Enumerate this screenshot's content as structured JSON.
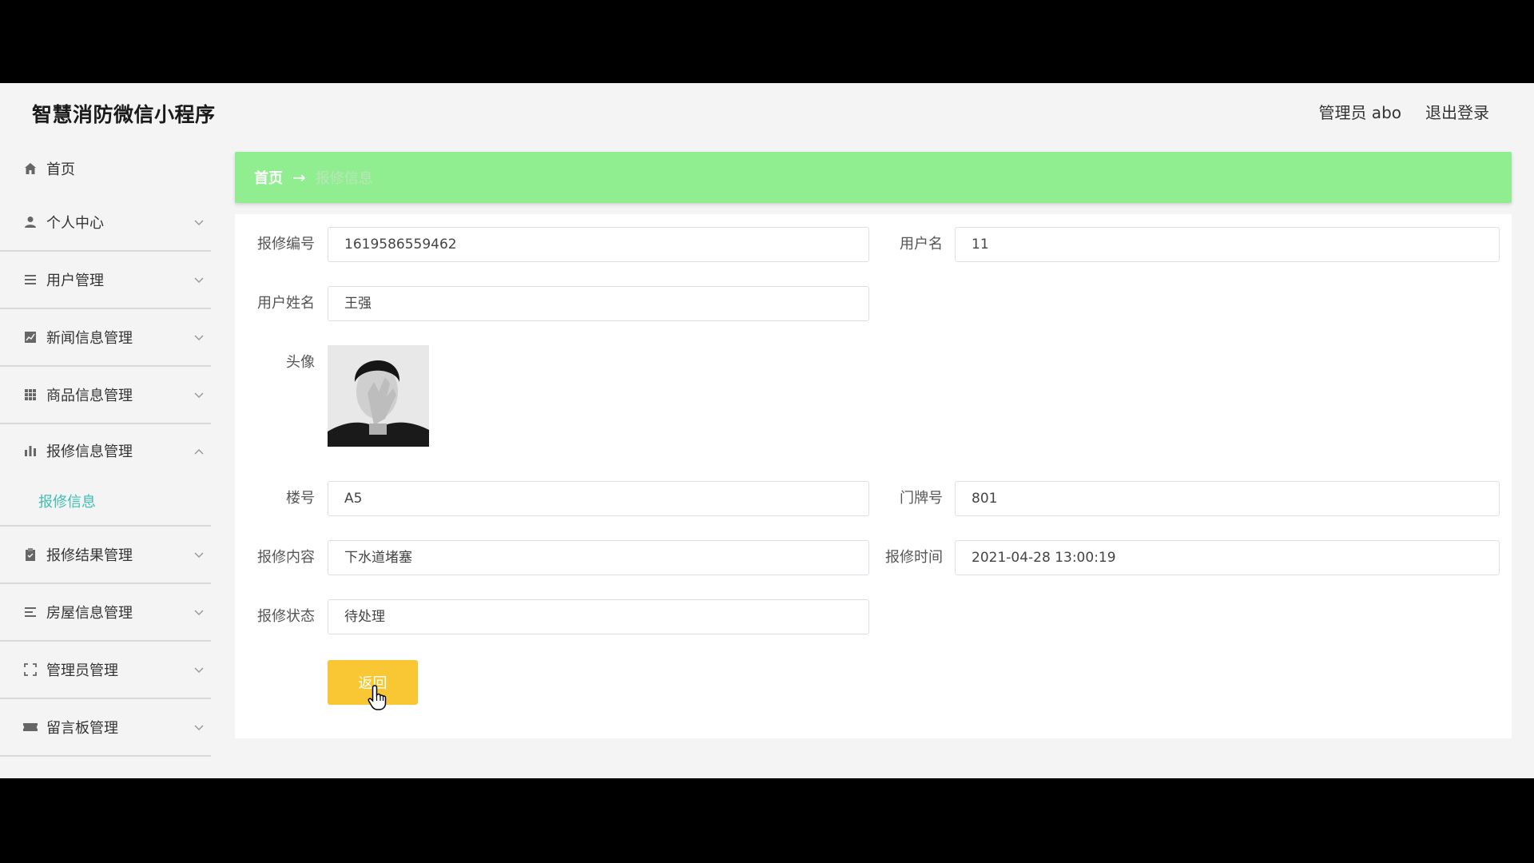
{
  "header": {
    "title": "智慧消防微信小程序",
    "user": "管理员 abo",
    "logout": "退出登录"
  },
  "sidebar": {
    "items": [
      {
        "label": "首页",
        "icon": "home-icon"
      },
      {
        "label": "个人中心",
        "icon": "user-icon"
      },
      {
        "label": "用户管理",
        "icon": "list-icon"
      },
      {
        "label": "新闻信息管理",
        "icon": "chart-line-icon"
      },
      {
        "label": "商品信息管理",
        "icon": "grid-icon"
      },
      {
        "label": "报修信息管理",
        "icon": "bar-chart-icon",
        "expanded": true
      },
      {
        "label": "报修结果管理",
        "icon": "clipboard-icon"
      },
      {
        "label": "房屋信息管理",
        "icon": "menu-icon"
      },
      {
        "label": "管理员管理",
        "icon": "fullscreen-icon"
      },
      {
        "label": "留言板管理",
        "icon": "ticket-icon"
      }
    ],
    "submenu_active": "报修信息"
  },
  "breadcrumb": {
    "home": "首页",
    "arrow": "→",
    "current": "报修信息"
  },
  "form": {
    "repair_no": {
      "label": "报修编号",
      "value": "1619586559462"
    },
    "username": {
      "label": "用户名",
      "value": "11"
    },
    "name": {
      "label": "用户姓名",
      "value": "王强"
    },
    "avatar": {
      "label": "头像"
    },
    "building": {
      "label": "楼号",
      "value": "A5"
    },
    "door": {
      "label": "门牌号",
      "value": "801"
    },
    "content": {
      "label": "报修内容",
      "value": "下水道堵塞"
    },
    "time": {
      "label": "报修时间",
      "value": "2021-04-28 13:00:19"
    },
    "status": {
      "label": "报修状态",
      "value": "待处理"
    },
    "back_button": "返回"
  },
  "colors": {
    "breadcrumb_bg": "#90ee90",
    "back_button": "#f8c733",
    "submenu_active": "#3fbfb0"
  }
}
